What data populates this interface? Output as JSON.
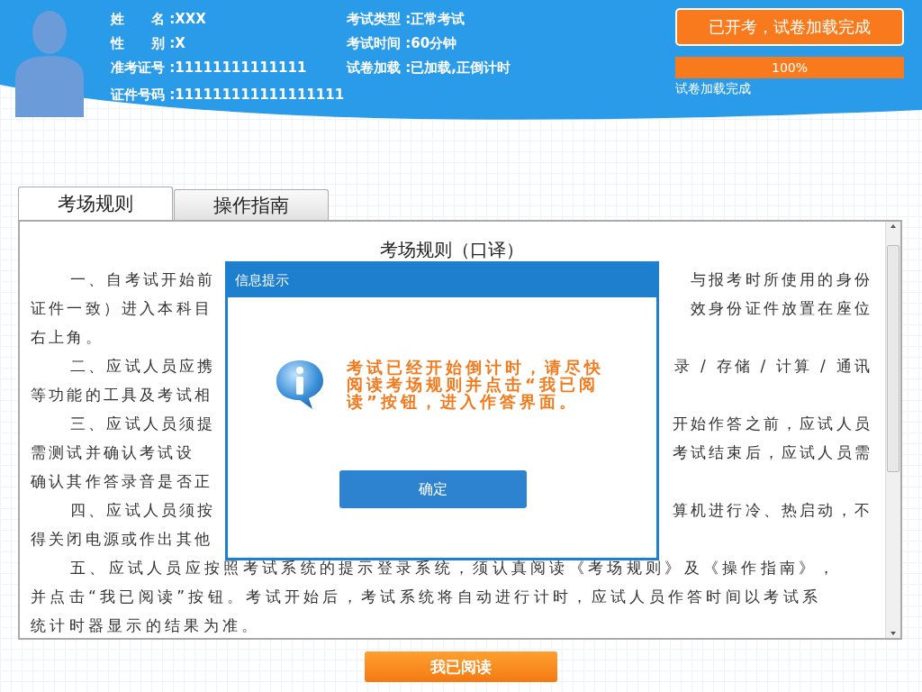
{
  "candidate": {
    "left_fields": [
      {
        "label": "姓　　名 :",
        "value": "XXX"
      },
      {
        "label": "性　　别 :",
        "value": "X"
      },
      {
        "label": "准考证号 :",
        "value": "11111111111111"
      },
      {
        "label": "证件号码 :",
        "value": "111111111111111111"
      }
    ],
    "right_fields": [
      {
        "label": "考试类型 :",
        "value": "正常考试"
      },
      {
        "label": "考试时间 :",
        "value": "60分钟"
      },
      {
        "label": "试卷加载 :",
        "value": "已加载,正倒计时"
      }
    ]
  },
  "status": {
    "button": "已开考，试卷加载完成",
    "level": 1,
    "reading": "100%",
    "caption": "试卷加载完成"
  },
  "tabs": [
    {
      "label": "考场规则",
      "selected": true
    },
    {
      "label": "操作指南",
      "selected": false
    }
  ],
  "document": {
    "title": "考场规则（口译）",
    "lines": [
      {
        "indent": true,
        "left": "一、自考试开始前",
        "right": "与报考时所使用的身份"
      },
      {
        "indent": false,
        "left": "证件一致）进入本科目",
        "right": "效身份证件放置在座位"
      },
      {
        "indent": false,
        "left": "右上角。"
      },
      {
        "indent": true,
        "left": "二、应试人员应携",
        "right": "录 / 存储 / 计算 / 通讯"
      },
      {
        "indent": false,
        "left": "等功能的工具及考试相"
      },
      {
        "indent": true,
        "left": "三、应试人员须提",
        "right": "开始作答之前，应试人员"
      },
      {
        "indent": false,
        "left": "需测试并确认考试设",
        "right": "考试结束后，应试人员需"
      },
      {
        "indent": false,
        "left": "确认其作答录音是否正"
      },
      {
        "indent": true,
        "left": "四、应试人员须按",
        "right": "算机进行冷、热启动，不"
      },
      {
        "indent": false,
        "left": "得关闭电源或作出其他"
      },
      {
        "indent": true,
        "full": "五、应试人员应按照考试系统的提示登录系统，须认真阅读《考场规则》及《操作指南》，"
      },
      {
        "indent": false,
        "full": "并点击“我已阅读”按钮。考试开始后，考试系统将自动进行计时，应试人员作答时间以考试系"
      },
      {
        "indent": false,
        "full": "统计时器显示的结果为准。"
      }
    ]
  },
  "dialog": {
    "title": "信息提示",
    "message": "考试已经开始倒计时，请尽快阅读考场规则并点击“我已阅读”按钮，进入作答界面。",
    "button": "确定"
  },
  "read_button": "我已阅读"
}
